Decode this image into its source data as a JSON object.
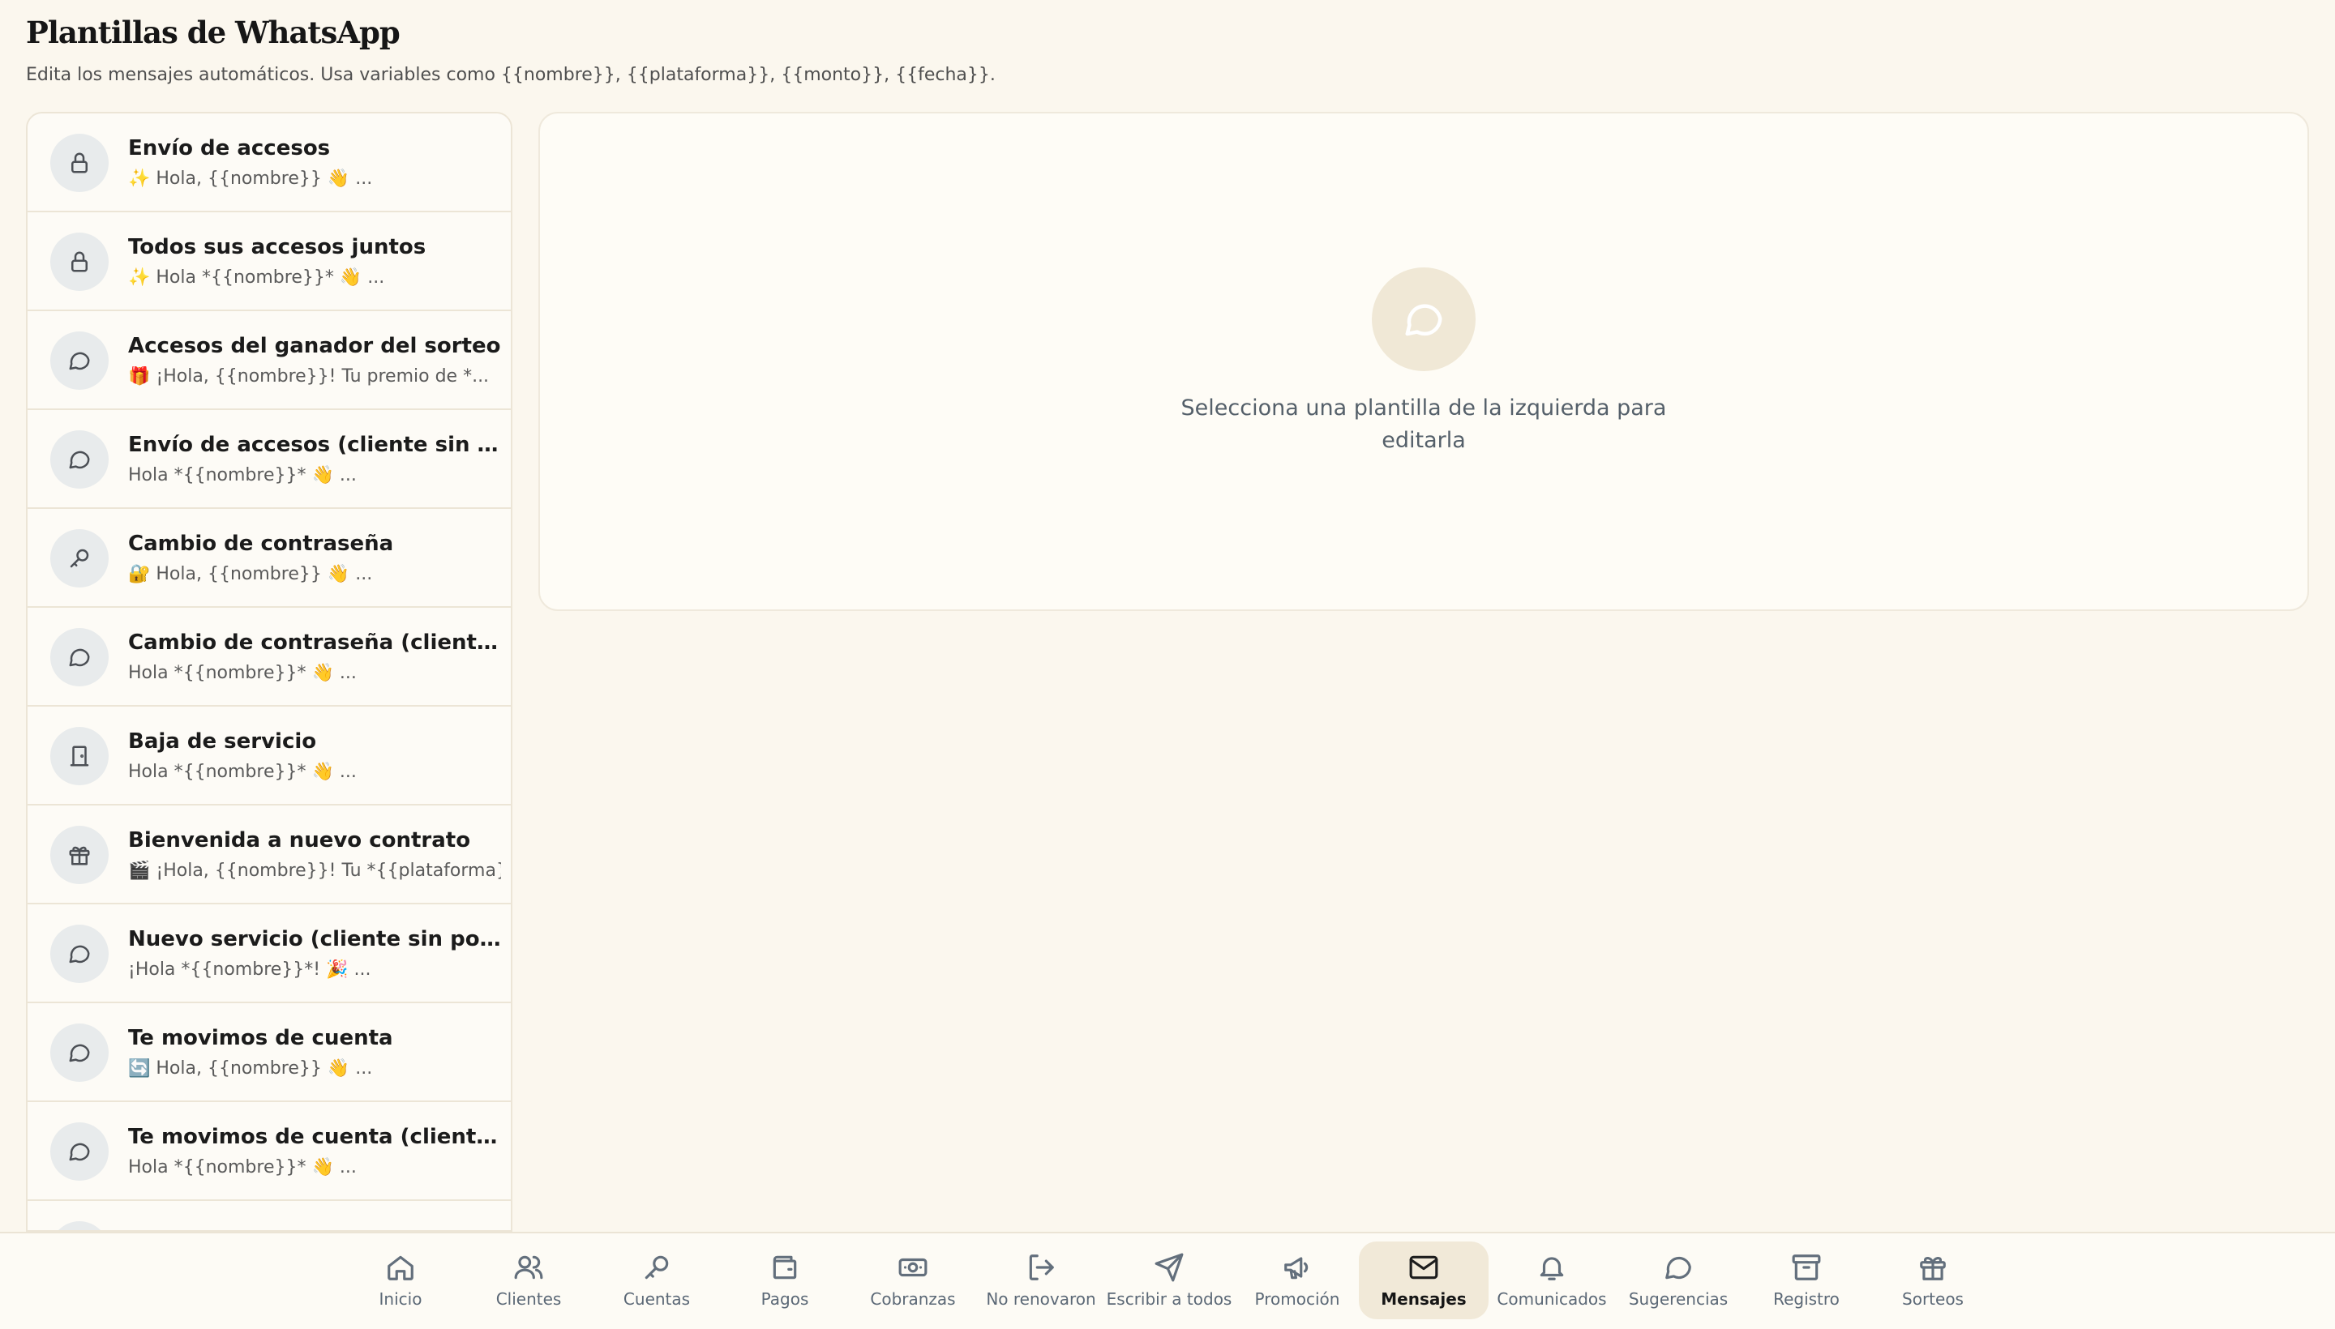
{
  "header": {
    "title": "Plantillas de WhatsApp",
    "subtitle": "Edita los mensajes automáticos. Usa variables como {{nombre}}, {{plataforma}}, {{monto}}, {{fecha}}."
  },
  "templates": [
    {
      "title": "Envío de accesos",
      "preview": "✨ Hola, {{nombre}} 👋 ...",
      "icon": "lock-icon"
    },
    {
      "title": "Todos sus accesos juntos",
      "preview": "✨ Hola *{{nombre}}* 👋 ...",
      "icon": "lock-icon"
    },
    {
      "title": "Accesos del ganador del sorteo",
      "preview": "🎁 ¡Hola, {{nombre}}! Tu premio de *...",
      "icon": "chat-bubble-icon"
    },
    {
      "title": "Envío de accesos (cliente sin portal)",
      "preview": "Hola *{{nombre}}* 👋 ...",
      "icon": "chat-bubble-icon"
    },
    {
      "title": "Cambio de contraseña",
      "preview": "🔐 Hola, {{nombre}} 👋 ...",
      "icon": "key-icon"
    },
    {
      "title": "Cambio de contraseña (cliente sin...",
      "preview": "Hola *{{nombre}}* 👋 ...",
      "icon": "chat-bubble-icon"
    },
    {
      "title": "Baja de servicio",
      "preview": "Hola *{{nombre}}* 👋 ...",
      "icon": "door-icon"
    },
    {
      "title": "Bienvenida a nuevo contrato",
      "preview": "🎬 ¡Hola, {{nombre}}! Tu *{{plataforma}}...",
      "icon": "gift-icon"
    },
    {
      "title": "Nuevo servicio (cliente sin portal)",
      "preview": "¡Hola *{{nombre}}*! 🎉 ...",
      "icon": "chat-bubble-icon"
    },
    {
      "title": "Te movimos de cuenta",
      "preview": "🔄 Hola, {{nombre}} 👋 ...",
      "icon": "chat-bubble-icon"
    },
    {
      "title": "Te movimos de cuenta (cliente sin ...",
      "preview": "Hola *{{nombre}}* 👋 ...",
      "icon": "chat-bubble-icon"
    },
    {
      "title": "",
      "preview": "",
      "icon": "chat-bubble-icon"
    }
  ],
  "editor": {
    "empty_message": "Selecciona una plantilla de la izquierda para editarla",
    "empty_icon": "chat-bubble-icon"
  },
  "nav": {
    "items": [
      {
        "label": "Inicio",
        "icon": "home-icon"
      },
      {
        "label": "Clientes",
        "icon": "users-icon"
      },
      {
        "label": "Cuentas",
        "icon": "key-icon"
      },
      {
        "label": "Pagos",
        "icon": "wallet-icon"
      },
      {
        "label": "Cobranzas",
        "icon": "banknote-icon"
      },
      {
        "label": "No renovaron",
        "icon": "logout-icon"
      },
      {
        "label": "Escribir a todos",
        "icon": "send-icon"
      },
      {
        "label": "Promoción",
        "icon": "megaphone-icon"
      },
      {
        "label": "Mensajes",
        "icon": "mail-icon",
        "active": true
      },
      {
        "label": "Comunicados",
        "icon": "bell-icon"
      },
      {
        "label": "Sugerencias",
        "icon": "chat-bubble-icon"
      },
      {
        "label": "Registro",
        "icon": "archive-icon"
      },
      {
        "label": "Sorteos",
        "icon": "gift-icon"
      }
    ]
  },
  "colors": {
    "background": "#fbf7ee",
    "active_tab": "#f1e9d8",
    "icon_circle": "#e8ebec"
  }
}
